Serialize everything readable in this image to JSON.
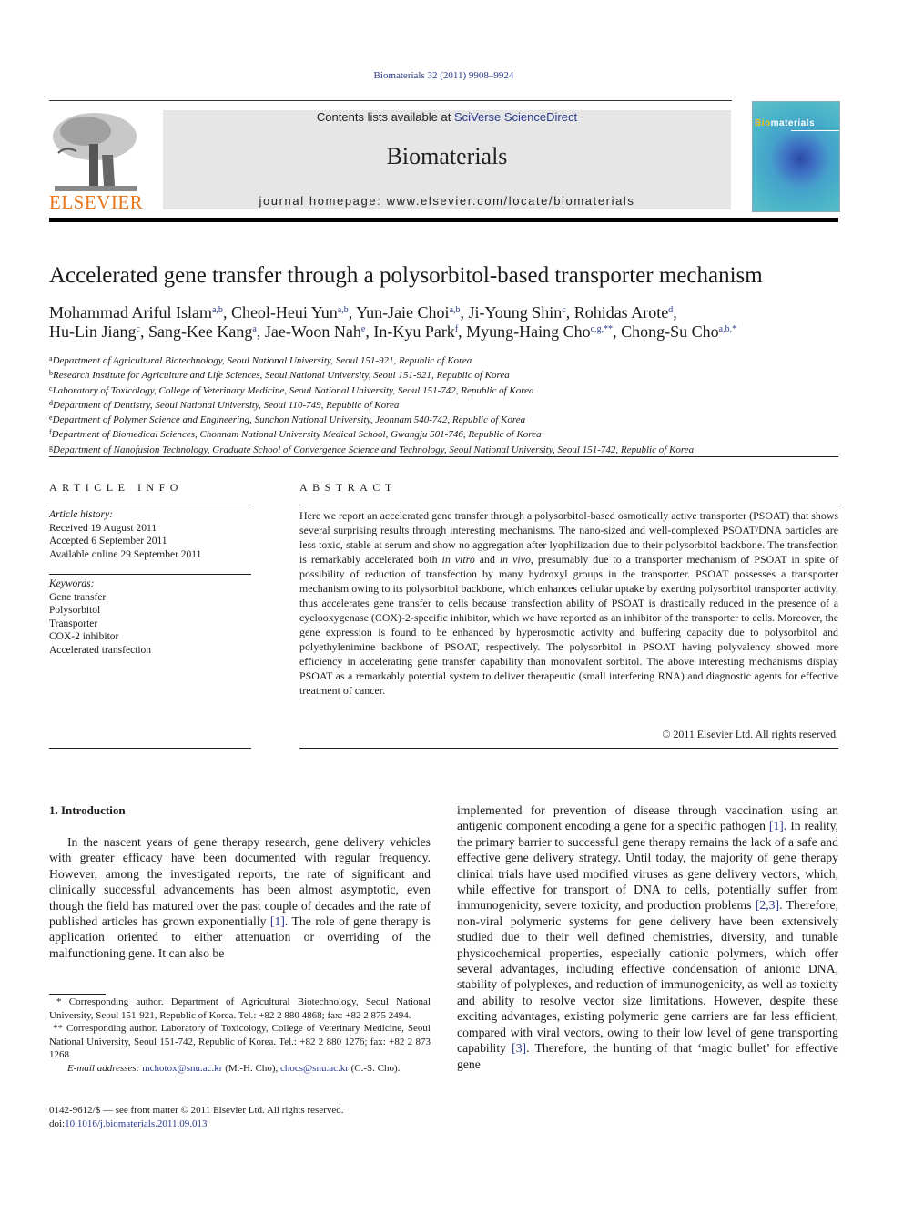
{
  "header": {
    "journal_ref": "Biomaterials 32 (2011) 9908–9924",
    "contents_prefix": "Contents lists available at ",
    "contents_link": "SciVerse ScienceDirect",
    "journal_name": "Biomaterials",
    "homepage_label": "journal homepage: ",
    "homepage_url": "www.elsevier.com/locate/biomaterials",
    "publisher_logo_text": "ELSEVIER",
    "cover_title_highlight": "Bio",
    "cover_title_rest": "materials"
  },
  "article": {
    "title": "Accelerated gene transfer through a polysorbitol-based transporter mechanism",
    "authors_line1": [
      {
        "name": "Mohammad Ariful Islam",
        "sup": "a,b",
        "sep": ", "
      },
      {
        "name": "Cheol-Heui Yun",
        "sup": "a,b",
        "sep": ", "
      },
      {
        "name": "Yun-Jaie Choi",
        "sup": "a,b",
        "sep": ", "
      },
      {
        "name": "Ji-Young Shin",
        "sup": "c",
        "sep": ", "
      },
      {
        "name": "Rohidas Arote",
        "sup": "d",
        "sep": ","
      }
    ],
    "authors_line2": [
      {
        "name": "Hu-Lin Jiang",
        "sup": "c",
        "sep": ", "
      },
      {
        "name": "Sang-Kee Kang",
        "sup": "a",
        "sep": ", "
      },
      {
        "name": "Jae-Woon Nah",
        "sup": "e",
        "sep": ", "
      },
      {
        "name": "In-Kyu Park",
        "sup": "f",
        "sep": ", "
      },
      {
        "name": "Myung-Haing Cho",
        "sup": "c,g,**",
        "sep": ", "
      },
      {
        "name": "Chong-Su Cho",
        "sup": "a,b,*",
        "sep": ""
      }
    ],
    "affiliations": [
      {
        "key": "a",
        "text": "Department of Agricultural Biotechnology, Seoul National University, Seoul 151-921, Republic of Korea"
      },
      {
        "key": "b",
        "text": "Research Institute for Agriculture and Life Sciences, Seoul National University, Seoul 151-921, Republic of Korea"
      },
      {
        "key": "c",
        "text": "Laboratory of Toxicology, College of Veterinary Medicine, Seoul National University, Seoul 151-742, Republic of Korea"
      },
      {
        "key": "d",
        "text": "Department of Dentistry, Seoul National University, Seoul 110-749, Republic of Korea"
      },
      {
        "key": "e",
        "text": "Department of Polymer Science and Engineering, Sunchon National University, Jeonnam 540-742, Republic of Korea"
      },
      {
        "key": "f",
        "text": "Department of Biomedical Sciences, Chonnam National University Medical School, Gwangju 501-746, Republic of Korea"
      },
      {
        "key": "g",
        "text": "Department of Nanofusion Technology, Graduate School of Convergence Science and Technology, Seoul National University, Seoul 151-742, Republic of Korea"
      }
    ]
  },
  "article_info": {
    "heading": "ARTICLE INFO",
    "history_label": "Article history:",
    "received": "Received 19 August 2011",
    "accepted": "Accepted 6 September 2011",
    "online": "Available online 29 September 2011",
    "keywords_label": "Keywords:",
    "keywords": [
      "Gene transfer",
      "Polysorbitol",
      "Transporter",
      "COX-2 inhibitor",
      "Accelerated transfection"
    ]
  },
  "abstract": {
    "heading": "ABSTRACT",
    "p1": "Here we report an accelerated gene transfer through a polysorbitol-based osmotically active transporter (PSOAT) that shows several surprising results through interesting mechanisms. The nano-sized and well-complexed PSOAT/DNA particles are less toxic, stable at serum and show no aggregation after lyophilization due to their polysorbitol backbone. The transfection is remarkably accelerated both ",
    "italic1": "in vitro",
    "p2": " and ",
    "italic2": "in vivo",
    "p3": ", presumably due to a transporter mechanism of PSOAT in spite of possibility of reduction of transfection by many hydroxyl groups in the transporter. PSOAT possesses a transporter mechanism owing to its polysorbitol backbone, which enhances cellular uptake by exerting polysorbitol transporter activity, thus accelerates gene transfer to cells because transfection ability of PSOAT is drastically reduced in the presence of a cyclooxygenase (COX)-2-specific inhibitor, which we have reported as an inhibitor of the transporter to cells. Moreover, the gene expression is found to be enhanced by hyperosmotic activity and buffering capacity due to polysorbitol and polyethylenimine backbone of PSOAT, respectively. The polysorbitol in PSOAT having polyvalency showed more efficiency in accelerating gene transfer capability than monovalent sorbitol. The above interesting mechanisms display PSOAT as a remarkably potential system to deliver therapeutic (small interfering RNA) and diagnostic agents for effective treatment of cancer.",
    "copyright": "© 2011 Elsevier Ltd. All rights reserved."
  },
  "body": {
    "intro_heading": "1.  Introduction",
    "left_a": "In the nascent years of gene therapy research, gene delivery vehicles with greater efficacy have been documented with regular frequency. However, among the investigated reports, the rate of significant and clinically successful advancements has been almost asymptotic, even though the field has matured over the past couple of decades and the rate of published articles has grown exponentially ",
    "left_ref": "[1]",
    "left_b": ". The role of gene therapy is application oriented to either attenuation or overriding of the malfunctioning gene. It can also be",
    "right_a": "implemented for prevention of disease through vaccination using an antigenic component encoding a gene for a specific pathogen ",
    "right_ref1": "[1]",
    "right_b": ". In reality, the primary barrier to successful gene therapy remains the lack of a safe and effective gene delivery strategy. Until today, the majority of gene therapy clinical trials have used modified viruses as gene delivery vectors, which, while effective for transport of DNA to cells, potentially suffer from immunogenicity, severe toxicity, and production problems ",
    "right_ref2": "[2,3]",
    "right_c": ". Therefore, non-viral polymeric systems for gene delivery have been extensively studied due to their well defined chemistries, diversity, and tunable physicochemical properties, especially cationic polymers, which offer several advantages, including effective condensation of anionic DNA, stability of polyplexes, and reduction of immunogenicity, as well as toxicity and ability to resolve vector size limitations. However, despite these exciting advantages, existing polymeric gene carriers are far less efficient, compared with viral vectors, owing to their low level of gene transporting capability ",
    "right_ref3": "[3]",
    "right_d": ". Therefore, the hunting of that ‘magic bullet’ for effective gene"
  },
  "footnotes": {
    "fn1": "* Corresponding author. Department of Agricultural Biotechnology, Seoul National University, Seoul 151-921, Republic of Korea. Tel.: +82 2 880 4868; fax: +82 2 875 2494.",
    "fn2": "** Corresponding author. Laboratory of Toxicology, College of Veterinary Medicine, Seoul National University, Seoul 151-742, Republic of Korea. Tel.: +82 2 880 1276; fax: +82 2 873 1268.",
    "email_label": "E-mail addresses: ",
    "email1": "mchotox@snu.ac.kr",
    "email1_who": " (M.-H. Cho), ",
    "email2": "chocs@snu.ac.kr",
    "email2_who": " (C.-S. Cho).",
    "issn_line": "0142-9612/$ — see front matter © 2011 Elsevier Ltd. All rights reserved.",
    "doi_label": "doi:",
    "doi": "10.1016/j.biomaterials.2011.09.013"
  }
}
